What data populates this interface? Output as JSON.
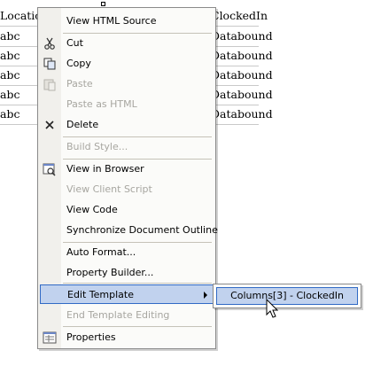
{
  "grid": {
    "header": {
      "col1": "Location",
      "col3": "ClockedIn"
    },
    "rows": [
      {
        "col1": "abc",
        "col3": "Databound"
      },
      {
        "col1": "abc",
        "col3": "Databound"
      },
      {
        "col1": "abc",
        "col3": "Databound"
      },
      {
        "col1": "abc",
        "col3": "Databound"
      },
      {
        "col1": "abc",
        "col3": "Databound"
      }
    ]
  },
  "context_menu": {
    "items": [
      {
        "label": "View HTML Source",
        "enabled": true,
        "icon": ""
      },
      {
        "label": "Cut",
        "enabled": true,
        "icon": "scissors-icon"
      },
      {
        "label": "Copy",
        "enabled": true,
        "icon": "copy-icon"
      },
      {
        "label": "Paste",
        "enabled": false,
        "icon": "paste-icon"
      },
      {
        "label": "Paste as HTML",
        "enabled": false,
        "icon": ""
      },
      {
        "label": "Delete",
        "enabled": true,
        "icon": "delete-icon"
      },
      {
        "label": "Build Style...",
        "enabled": false,
        "icon": ""
      },
      {
        "label": "View in Browser",
        "enabled": true,
        "icon": "view-in-browser-icon"
      },
      {
        "label": "View Client Script",
        "enabled": false,
        "icon": ""
      },
      {
        "label": "View Code",
        "enabled": true,
        "icon": ""
      },
      {
        "label": "Synchronize Document Outline",
        "enabled": true,
        "icon": ""
      },
      {
        "label": "Auto Format...",
        "enabled": true,
        "icon": ""
      },
      {
        "label": "Property Builder...",
        "enabled": true,
        "icon": ""
      },
      {
        "label": "Edit Template",
        "enabled": true,
        "icon": "",
        "submenu": true,
        "highlighted": true
      },
      {
        "label": "End Template Editing",
        "enabled": false,
        "icon": ""
      },
      {
        "label": "Properties",
        "enabled": true,
        "icon": "properties-icon"
      }
    ]
  },
  "submenu": {
    "items": [
      {
        "label": "Columns[3] - ClockedIn",
        "highlighted": true
      }
    ]
  },
  "colors": {
    "highlight": "#c1d2ee",
    "highlight_border": "#316ac5",
    "disabled_text": "#a7a6a0"
  }
}
